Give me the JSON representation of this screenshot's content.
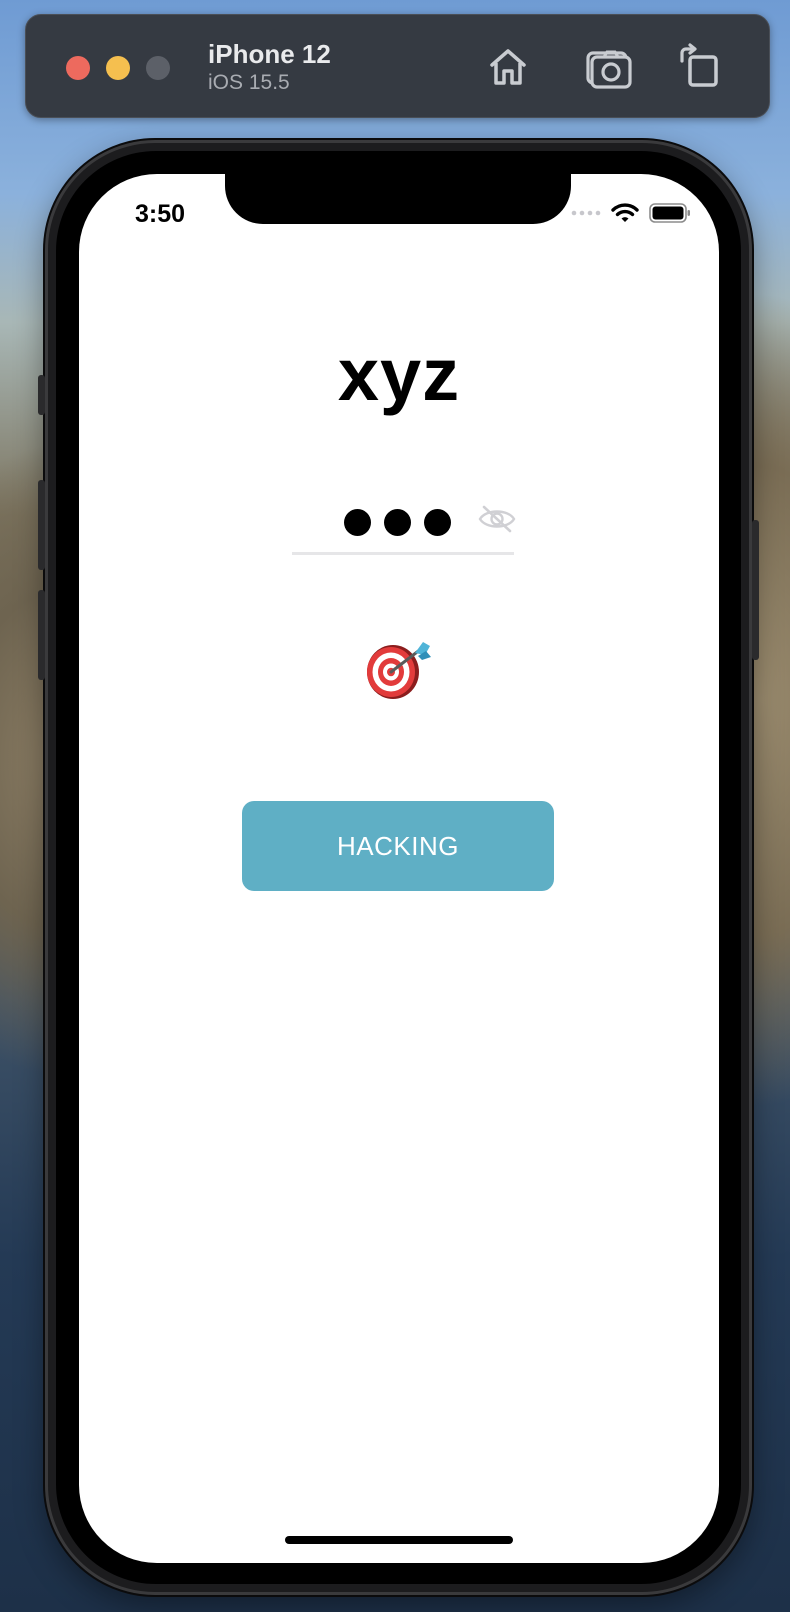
{
  "simulator": {
    "device_name": "iPhone 12",
    "os_version": "iOS 15.5",
    "toolbar_icons": [
      "home-icon",
      "screenshot-icon",
      "rotate-icon"
    ]
  },
  "status_bar": {
    "time": "3:50",
    "icons": [
      "signal-icon",
      "wifi-icon",
      "battery-icon"
    ]
  },
  "app": {
    "title": "xyz",
    "password": {
      "masked_length": 3,
      "visibility_icon": "eye-slash-icon"
    },
    "emoji": "direct-hit-icon",
    "button_label": "HACKING"
  },
  "colors": {
    "button": "#5fafc5",
    "button_text": "#ffffff",
    "title": "#000000",
    "underline": "#e6e6e8"
  }
}
